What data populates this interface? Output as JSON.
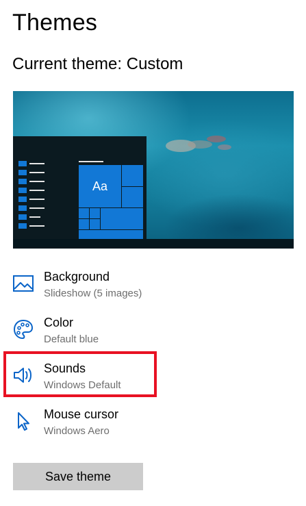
{
  "page": {
    "title": "Themes",
    "current_theme_label": "Current theme: Custom"
  },
  "preview": {
    "tile_text": "Aa"
  },
  "settings": [
    {
      "title": "Background",
      "subtitle": "Slideshow (5 images)",
      "icon": "picture-icon"
    },
    {
      "title": "Color",
      "subtitle": "Default blue",
      "icon": "palette-icon"
    },
    {
      "title": "Sounds",
      "subtitle": "Windows Default",
      "icon": "speaker-icon"
    },
    {
      "title": "Mouse cursor",
      "subtitle": "Windows Aero",
      "icon": "cursor-icon"
    }
  ],
  "actions": {
    "save_label": "Save theme"
  },
  "colors": {
    "accent": "#1278d6",
    "icon": "#0a64c8",
    "highlight": "#e81123",
    "button_bg": "#cccccc",
    "subtitle": "#6e6e6e"
  }
}
